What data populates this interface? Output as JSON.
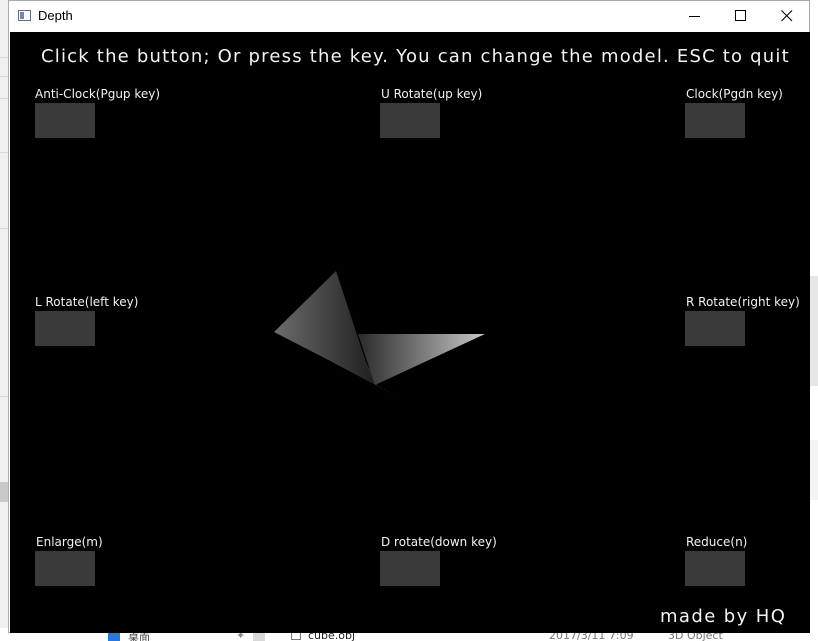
{
  "window": {
    "title": "Depth",
    "icon": "app-window-icon",
    "controls": [
      "minimize-icon",
      "maximize-icon",
      "close-icon"
    ]
  },
  "canvas": {
    "instructions": "Click the button; Or press the key. You can change the model. ESC to quit",
    "credit": "made by HQ",
    "buttons": {
      "anticlock": "Anti-Clock(Pgup key)",
      "urotate": "U Rotate(up key)",
      "clock": "Clock(Pgdn key)",
      "lrotate": "L Rotate(left key)",
      "rrotate": "R Rotate(right key)",
      "enlarge": "Enlarge(m)",
      "drotate": "D rotate(down key)",
      "reduce": "Reduce(n)"
    }
  },
  "background": {
    "file_name": "cube.obj",
    "file_date": "2017/3/11 7:09",
    "file_type": "3D Object",
    "nav_item": "桌面"
  },
  "colors": {
    "canvas_bg": "#000000",
    "button_fill": "#3a3a3a",
    "text": "#f2f2f2"
  }
}
